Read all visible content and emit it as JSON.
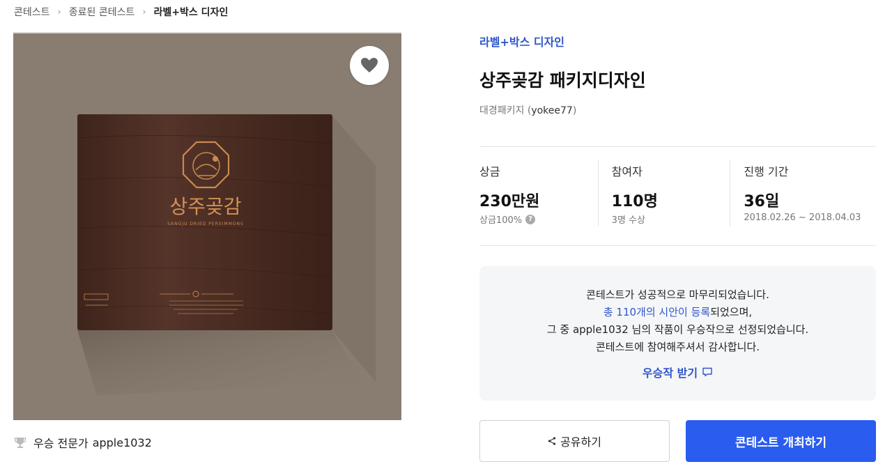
{
  "breadcrumb": {
    "items": [
      "콘테스트",
      "종료된 콘테스트",
      "라벨+박스 디자인"
    ]
  },
  "image": {
    "product_title": "상주곶감",
    "product_subtitle": "SANGJU DRIED PERSIMMONS",
    "background_color": "#897d71",
    "box_color": "#4a2c22"
  },
  "winner": {
    "label": "우승 전문가",
    "name": "apple1032"
  },
  "contest": {
    "category": "라벨+박스 디자인",
    "title": "상주곶감 패키지디자인",
    "host_name": "대경패키지",
    "host_id": "yokee77"
  },
  "stats": {
    "prize": {
      "label": "상금",
      "value": "230만원",
      "sub": "상금100%"
    },
    "participants": {
      "label": "참여자",
      "value": "110명",
      "sub": "3명 수상"
    },
    "period": {
      "label": "진행 기간",
      "value": "36일",
      "sub": "2018.02.26 ~ 2018.04.03"
    }
  },
  "notice": {
    "line1": "콘테스트가 성공적으로 마무리되었습니다.",
    "line2_highlight": "총 110개의 시안이 등록",
    "line2_rest": "되었으며,",
    "line3_prefix": "그 중 ",
    "line3_name": "apple1032",
    "line3_rest": " 님의 작품이 우승작으로 선정되었습니다.",
    "line4": "콘테스트에 참여해주셔서 감사합니다.",
    "receive_label": "우승작 받기"
  },
  "actions": {
    "share_label": "공유하기",
    "host_label": "콘테스트 개최하기"
  },
  "colors": {
    "accent": "#2e56c9",
    "primary_button": "#2b5cf0"
  }
}
